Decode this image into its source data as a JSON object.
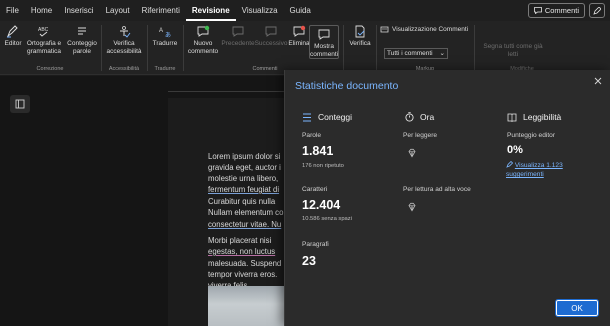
{
  "menu": {
    "items": [
      "File",
      "Home",
      "Inserisci",
      "Layout",
      "Riferimenti",
      "Revisione",
      "Visualizza",
      "Guida"
    ],
    "active": "Revisione",
    "comments_button": "Commenti"
  },
  "ribbon": {
    "buttons": {
      "editor": "Editor",
      "spelling": "Ortografia e grammatica",
      "word_count": "Conteggio parole",
      "accessibility": "Verifica accessibilità",
      "translate": "Tradurre",
      "new_comment": "Nuovo commento",
      "prev_comment": "Precedente",
      "next_comment": "Successivo",
      "delete": "Elimina",
      "show_comments": "Mostra commenti",
      "check": "Verifica",
      "comments_view_label": "Visualizzazione Commenti",
      "comments_view_value": "Tutti i commenti",
      "track_all": "Segna tutti come già letti"
    },
    "groups": {
      "correction": "Correzione",
      "accessibility": "Accessibilità",
      "translate": "Tradurre",
      "comments": "Commenti",
      "markup": "Markup",
      "changes": "Modifiche"
    }
  },
  "document": {
    "lines": [
      "Lorem ipsum dolor si",
      "gravida eget, auctor i",
      "molestie urna libero,",
      "fermentum feugiat di",
      "Curabitur quis nulla",
      "Nullam elementum co",
      "consectetur vitae. Nu",
      "",
      "Morbi placerat nisi",
      "egestas, non luctus",
      "malesuada. Suspend",
      "tempor viverra eros.",
      "viverra felis."
    ]
  },
  "dialog": {
    "title": "Statistiche documento",
    "counts": {
      "header": "Conteggi",
      "words_label": "Parole",
      "words_value": "1.841",
      "words_sub": "176 non ripetuto",
      "chars_label": "Caratteri",
      "chars_value": "12.404",
      "chars_sub": "10.586 senza spazi",
      "paragraphs_label": "Paragrafi",
      "paragraphs_value": "23"
    },
    "time": {
      "header": "Ora",
      "reading_label": "Per leggere",
      "speaking_label": "Per lettura ad alta voce"
    },
    "readability": {
      "header": "Leggibilità",
      "score_label": "Punteggio editor",
      "score_value": "0%",
      "link_line1": "Visualizza 1.123",
      "link_line2": "suggerimenti"
    },
    "ok_button": "OK"
  },
  "colors": {
    "accent": "#7bb6ff",
    "ok_button": "#1d6bd1",
    "dialog_bg": "#2b2b2b"
  }
}
